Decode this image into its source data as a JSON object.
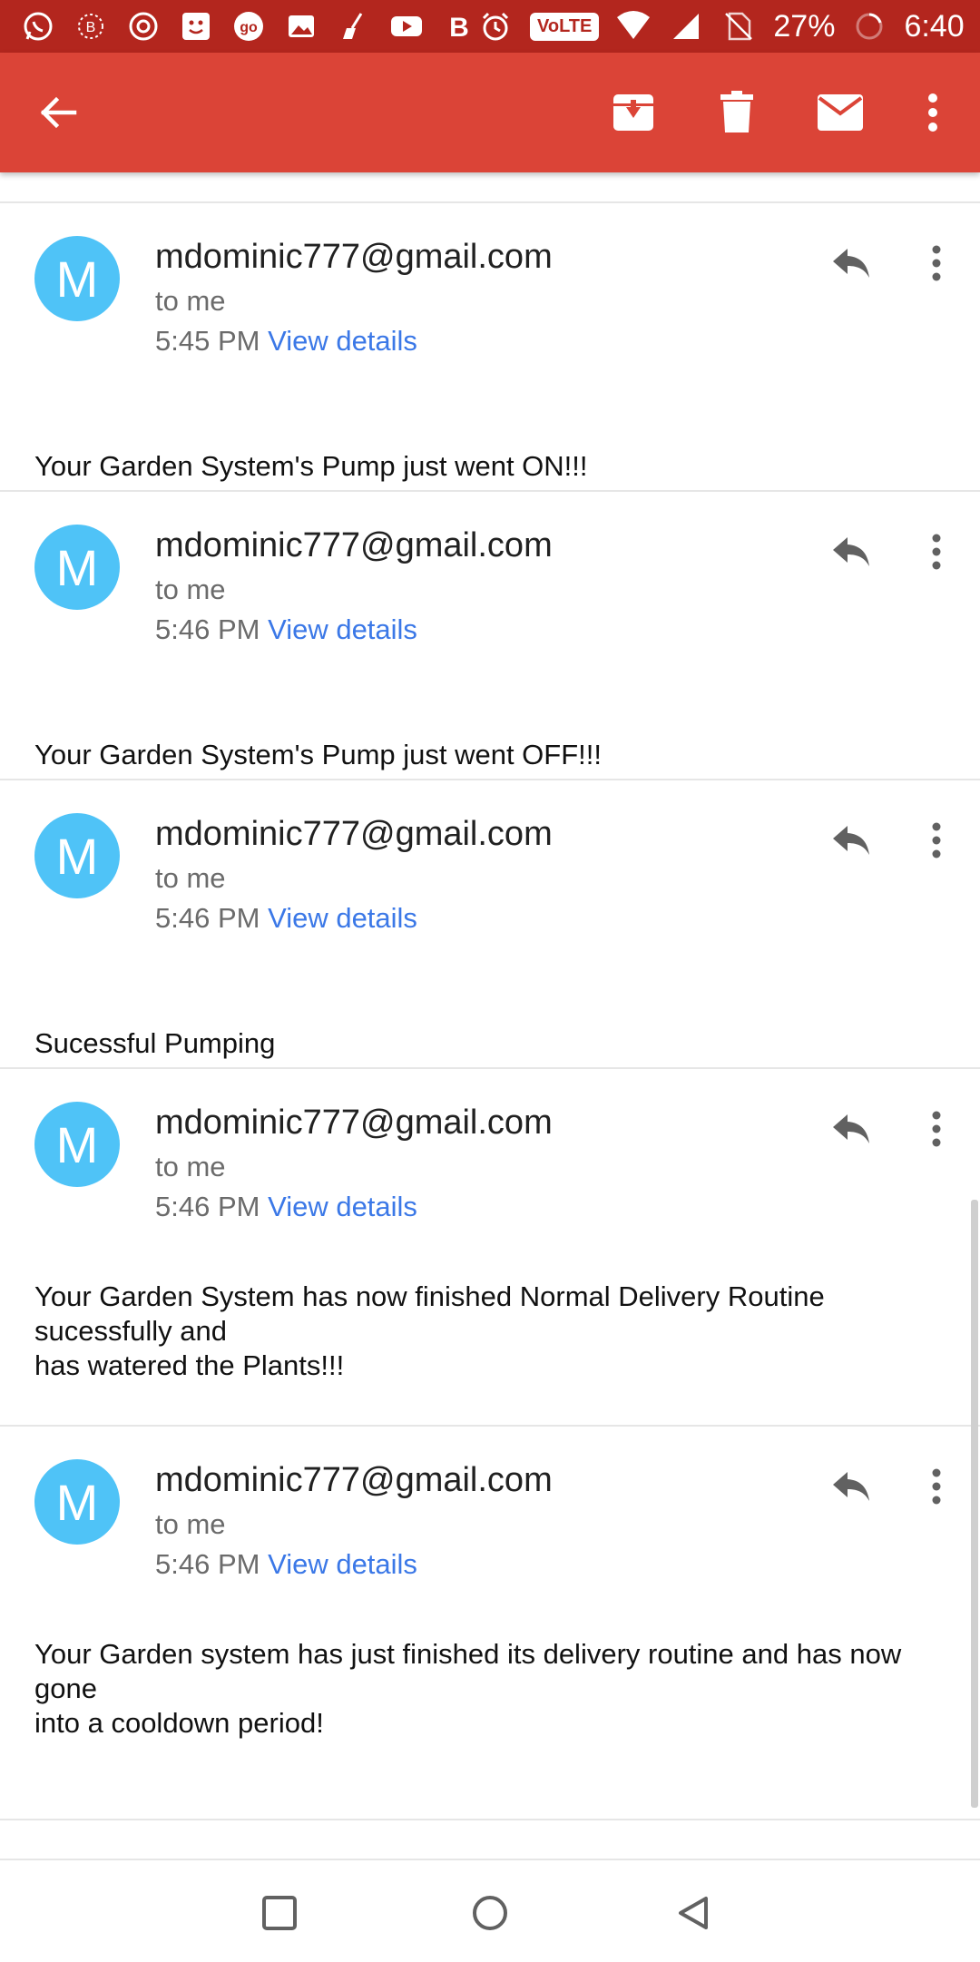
{
  "status_bar": {
    "left_icons": [
      "whatsapp-icon",
      "bluetooth-b-icon",
      "chrome-icon",
      "smiley-app-icon",
      "go-app-icon",
      "gallery-icon",
      "cleaner-icon",
      "youtube-icon",
      "b-app-icon"
    ],
    "volte": "VoLTE",
    "battery": "27%",
    "time": "6:40"
  },
  "toolbar": {
    "actions": [
      "back-arrow-icon",
      "archive-icon",
      "delete-icon",
      "mark-unread-icon",
      "more-vert-icon"
    ]
  },
  "messages": [
    {
      "avatar": "M",
      "sender": "mdominic777@gmail.com",
      "recipient": "to me",
      "time": "5:45 PM",
      "details": "View details",
      "body": "Your Garden System's Pump just went ON!!!"
    },
    {
      "avatar": "M",
      "sender": "mdominic777@gmail.com",
      "recipient": "to me",
      "time": "5:46 PM",
      "details": "View details",
      "body": "Your Garden System's Pump just went OFF!!!"
    },
    {
      "avatar": "M",
      "sender": "mdominic777@gmail.com",
      "recipient": "to me",
      "time": "5:46 PM",
      "details": "View details",
      "body": "Sucessful Pumping"
    },
    {
      "avatar": "M",
      "sender": "mdominic777@gmail.com",
      "recipient": "to me",
      "time": "5:46 PM",
      "details": "View details",
      "body": "Your Garden System has now finished Normal Delivery Routine\nsucessfully and\nhas watered the Plants!!!"
    },
    {
      "avatar": "M",
      "sender": "mdominic777@gmail.com",
      "recipient": "to me",
      "time": "5:46 PM",
      "details": "View details",
      "body": "Your Garden system has just finished its delivery routine and has now\ngone\ninto a cooldown period!"
    }
  ],
  "colors": {
    "status_bar": "#b3261e",
    "app_bar": "#db4437",
    "avatar": "#4fc3f7",
    "link": "#3b78e7"
  },
  "nav_bar": {
    "buttons": [
      "recents-square-icon",
      "home-circle-icon",
      "back-triangle-icon"
    ]
  }
}
